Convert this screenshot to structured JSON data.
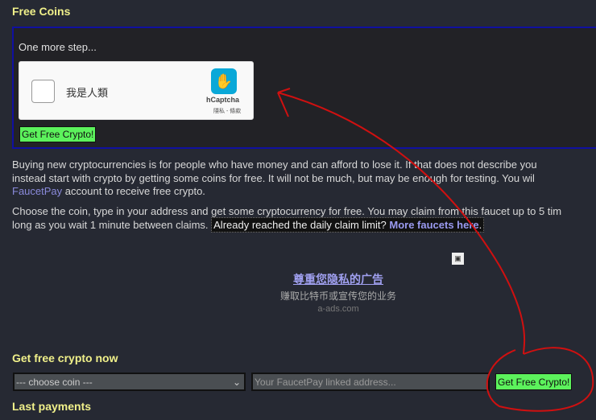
{
  "title": "Free Coins",
  "captcha": {
    "step": "One more step...",
    "label": "我是人類",
    "brand": "hCaptcha",
    "terms": "隱私 - 條款",
    "button": "Get Free Crypto!"
  },
  "intro": {
    "line1": "Buying new cryptocurrencies is for people who have money and can afford to lose it. If that does not describe you",
    "line2": "instead start with crypto by getting some coins for free. It will not be much, but may be enough for testing. You wil",
    "link": "FaucetPay",
    "line3": " account to receive free crypto."
  },
  "choose": {
    "line1": "Choose the coin, type in your address and get some cryptocurrency for free. You may claim from this faucet up to 5 tim",
    "line2": "long as you wait 1 minute between claims. ",
    "limit": "Already reached the daily claim limit? ",
    "more": "More faucets here",
    "dot": "."
  },
  "ad": {
    "title": "尊重您隐私的广告",
    "subtitle": "赚取比特币或宣传您的业务",
    "domain": "a-ads.com"
  },
  "form": {
    "heading": "Get free crypto now",
    "coin_select": "--- choose coin ---",
    "address_placeholder": "Your FaucetPay linked address...",
    "button": "Get Free Crypto!"
  },
  "last_payments": "Last payments"
}
